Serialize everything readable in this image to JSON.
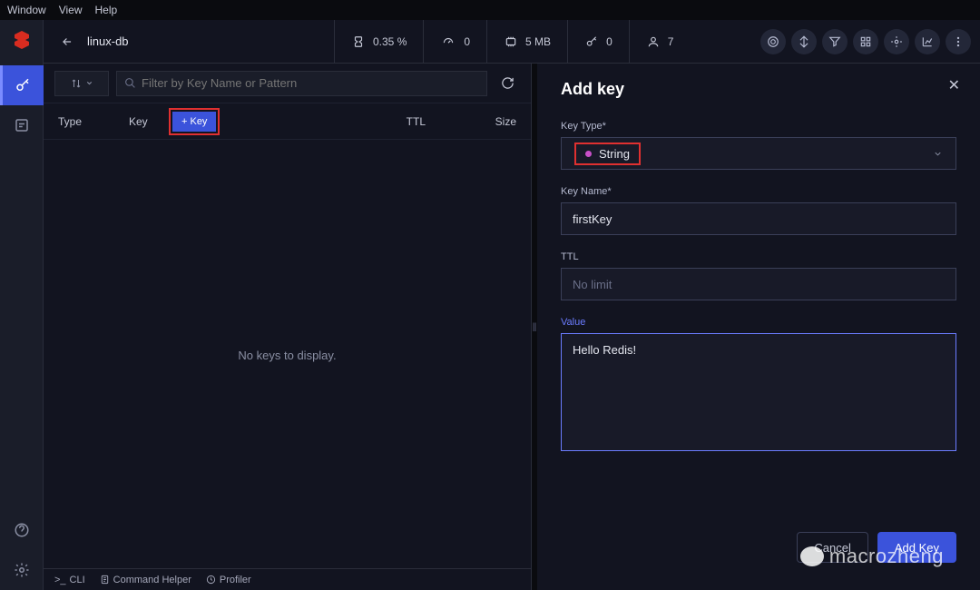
{
  "menubar": {
    "items": [
      "Window",
      "View",
      "Help"
    ]
  },
  "topbar": {
    "dbname": "linux-db",
    "stats": {
      "percent": "0.35 %",
      "speed": "0",
      "memory": "5 MB",
      "keys": "0",
      "clients": "7"
    }
  },
  "filter": {
    "placeholder": "Filter by Key Name or Pattern"
  },
  "headers": {
    "type": "Type",
    "key": "Key",
    "ttl": "TTL",
    "size": "Size"
  },
  "addKeyBtn": "+ Key",
  "emptyState": "No keys to display.",
  "bottomTabs": {
    "cli": "CLI",
    "helper": "Command Helper",
    "profiler": "Profiler"
  },
  "panel": {
    "title": "Add key",
    "keyTypeLabel": "Key Type*",
    "keyTypeValue": "String",
    "keyNameLabel": "Key Name*",
    "keyNameValue": "firstKey",
    "ttlLabel": "TTL",
    "ttlPlaceholder": "No limit",
    "valueLabel": "Value",
    "valueText": "Hello Redis!",
    "cancel": "Cancel",
    "submit": "Add Key"
  },
  "watermark": "macrozheng"
}
